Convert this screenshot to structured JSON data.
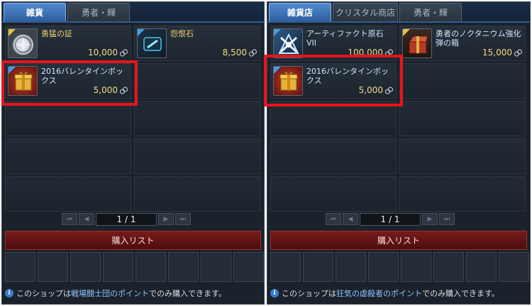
{
  "left": {
    "tabs": [
      {
        "label": "雑貨",
        "active": true
      },
      {
        "label": "勇者・輝",
        "active": false
      }
    ],
    "items": [
      {
        "name": "勇猛の証",
        "price": "10,000",
        "icon": "silver-emblem-icon"
      },
      {
        "name": "怨恨石",
        "price": "8,500",
        "icon": "crystal-stone-icon"
      },
      {
        "name": "2016バレンタインボックス",
        "price": "5,000",
        "icon": "gift-box-icon"
      }
    ],
    "pager": {
      "page": "1 / 1"
    },
    "buy_list_label": "購入リスト",
    "footer": {
      "prefix": "このショップは",
      "highlight": "戦場闘士団のポイント",
      "suffix": "でのみ購入できます。"
    }
  },
  "right": {
    "tabs": [
      {
        "label": "雑貨店",
        "active": true
      },
      {
        "label": "クリスタル商店",
        "active": false
      },
      {
        "label": "勇者・輝",
        "active": false
      }
    ],
    "items": [
      {
        "name": "アーティファクト原石VII",
        "price": "100,000",
        "icon": "artifact-crystal-icon"
      },
      {
        "name": "勇者のノクタニウム強化弾の箱",
        "price": "15,000",
        "icon": "red-box-icon"
      },
      {
        "name": "2016バレンタインボックス",
        "price": "5,000",
        "icon": "gift-box-icon"
      }
    ],
    "pager": {
      "page": "1 / 1"
    },
    "buy_list_label": "購入リスト",
    "footer": {
      "prefix": "このショップは",
      "highlight": "狂気の虐殺者のポイント",
      "suffix": "でのみ購入できます。"
    }
  },
  "icons": {
    "coin": "currency-coin-icon",
    "first": "⏮",
    "prev": "◀",
    "next": "▶",
    "last": "⏭",
    "info": "i"
  },
  "colors": {
    "highlight_frame": "#e8141b",
    "active_tab": "#3f78c0",
    "buy_header": "#6a1414",
    "footer_highlight": "#8ec3ff"
  }
}
